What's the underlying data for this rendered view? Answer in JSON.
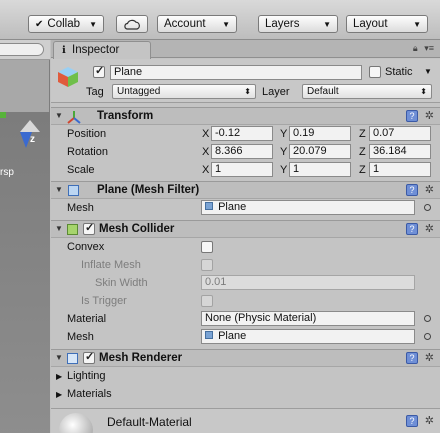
{
  "toolbar": {
    "collab": "Collab",
    "account": "Account",
    "layers": "Layers",
    "layout": "Layout"
  },
  "scene": {
    "side_label": "rsp",
    "axis_label": "z"
  },
  "inspector": {
    "tab_label": "Inspector",
    "object_name": "Plane",
    "static_label": "Static",
    "tag_label": "Tag",
    "tag_value": "Untagged",
    "layer_label": "Layer",
    "layer_value": "Default"
  },
  "transform": {
    "title": "Transform",
    "position_label": "Position",
    "rotation_label": "Rotation",
    "scale_label": "Scale",
    "axis_x": "X",
    "axis_y": "Y",
    "axis_z": "Z",
    "position": {
      "x": "-0.12",
      "y": "0.19",
      "z": "0.07"
    },
    "rotation": {
      "x": "8.366",
      "y": "20.079",
      "z": "36.184"
    },
    "scale": {
      "x": "1",
      "y": "1",
      "z": "1"
    }
  },
  "mesh_filter": {
    "title": "Plane (Mesh Filter)",
    "mesh_label": "Mesh",
    "mesh_value": "Plane"
  },
  "mesh_collider": {
    "title": "Mesh Collider",
    "convex_label": "Convex",
    "inflate_label": "Inflate Mesh",
    "skin_label": "Skin Width",
    "skin_value": "0.01",
    "trigger_label": "Is Trigger",
    "material_label": "Material",
    "material_value": "None (Physic Material)",
    "mesh_label": "Mesh",
    "mesh_value": "Plane"
  },
  "mesh_renderer": {
    "title": "Mesh Renderer",
    "lighting_label": "Lighting",
    "materials_label": "Materials"
  },
  "material": {
    "name": "Default-Material"
  }
}
